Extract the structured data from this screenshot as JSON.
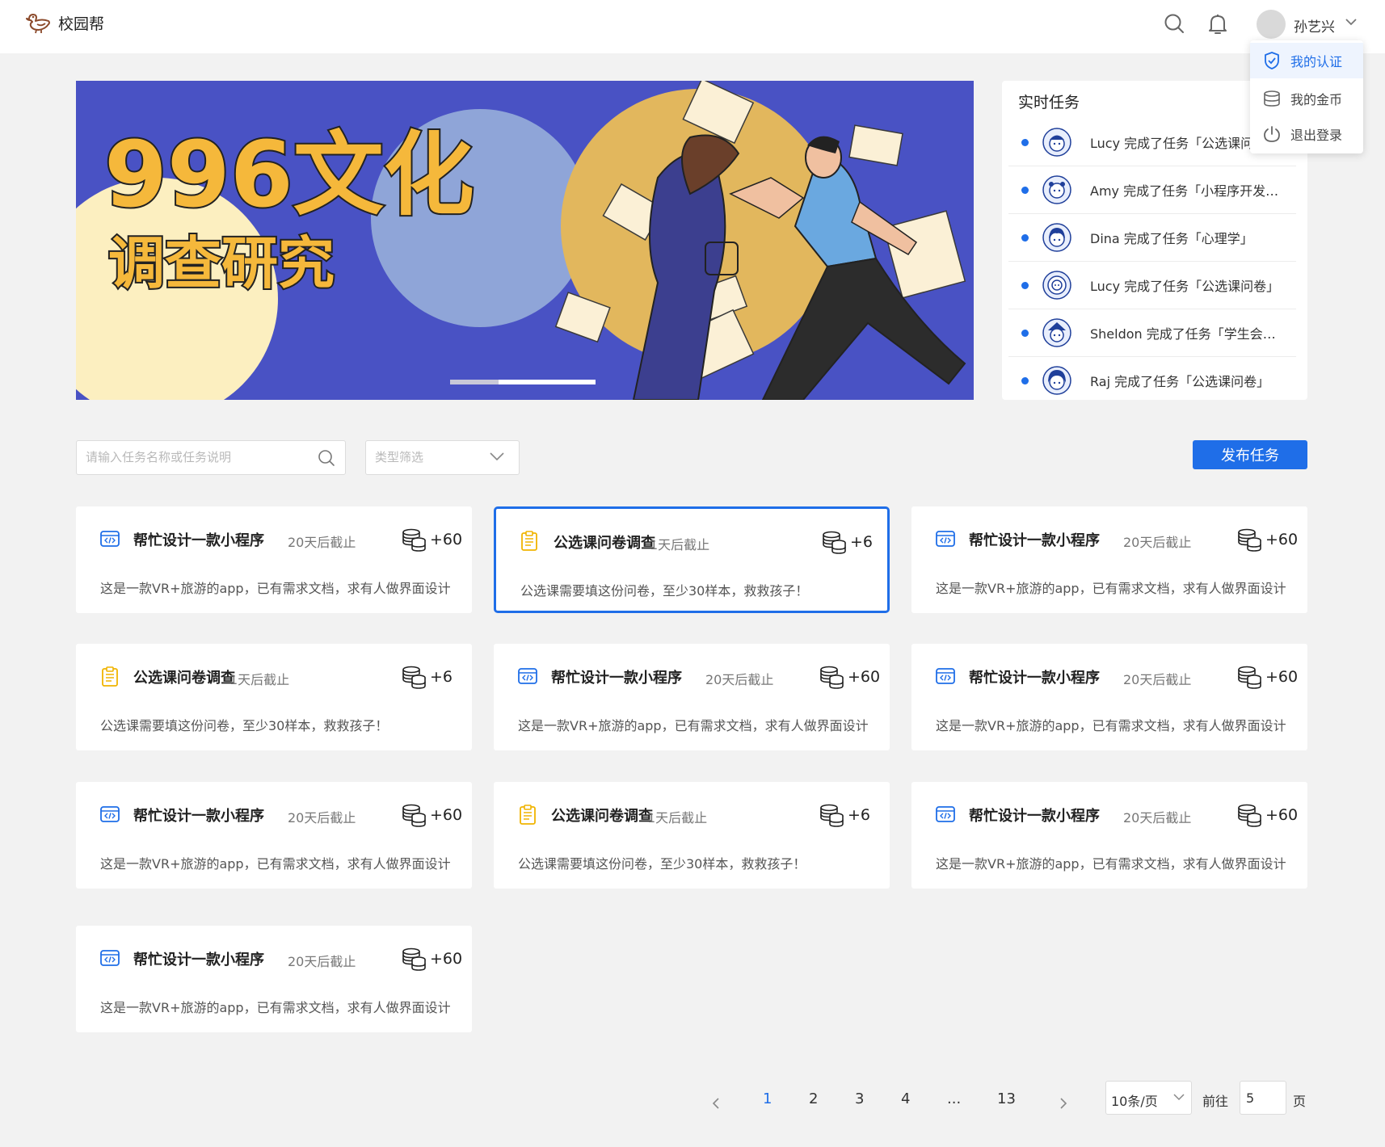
{
  "header": {
    "app_name": "校园帮",
    "user_name": "孙艺兴"
  },
  "user_menu": {
    "items": [
      {
        "label": "我的认证",
        "icon": "shield-check-icon",
        "active": true
      },
      {
        "label": "我的金币",
        "icon": "coins-icon",
        "active": false
      },
      {
        "label": "退出登录",
        "icon": "power-icon",
        "active": false
      }
    ]
  },
  "banner": {
    "line1": "996文化",
    "line2": "调查研究"
  },
  "realtime": {
    "title": "实时任务",
    "items": [
      "Lucy 完成了任务「公选课问卷」",
      "Amy 完成了任务「小程序开发…",
      "Dina 完成了任务「心理学」",
      "Lucy 完成了任务「公选课问卷」",
      "Sheldon 完成了任务「学生会…",
      "Raj 完成了任务「公选课问卷」"
    ]
  },
  "filters": {
    "search_placeholder": "请输入任务名称或任务说明",
    "type_placeholder": "类型筛选",
    "publish_label": "发布任务"
  },
  "tasks": [
    {
      "type": "code",
      "title": "帮忙设计一款小程序",
      "deadline": "20天后截止",
      "reward": "+60",
      "desc": "这是一款VR+旅游的app，已有需求文档，求有人做界面设计",
      "selected": false
    },
    {
      "type": "survey",
      "title": "公选课问卷调查",
      "deadline": "1天后截止",
      "reward": "+6",
      "desc": "公选课需要填这份问卷，至少30样本，救救孩子！",
      "selected": true
    },
    {
      "type": "code",
      "title": "帮忙设计一款小程序",
      "deadline": "20天后截止",
      "reward": "+60",
      "desc": "这是一款VR+旅游的app，已有需求文档，求有人做界面设计",
      "selected": false
    },
    {
      "type": "survey",
      "title": "公选课问卷调查",
      "deadline": "1天后截止",
      "reward": "+6",
      "desc": "公选课需要填这份问卷，至少30样本，救救孩子！",
      "selected": false
    },
    {
      "type": "code",
      "title": "帮忙设计一款小程序",
      "deadline": "20天后截止",
      "reward": "+60",
      "desc": "这是一款VR+旅游的app，已有需求文档，求有人做界面设计",
      "selected": false
    },
    {
      "type": "code",
      "title": "帮忙设计一款小程序",
      "deadline": "20天后截止",
      "reward": "+60",
      "desc": "这是一款VR+旅游的app，已有需求文档，求有人做界面设计",
      "selected": false
    },
    {
      "type": "code",
      "title": "帮忙设计一款小程序",
      "deadline": "20天后截止",
      "reward": "+60",
      "desc": "这是一款VR+旅游的app，已有需求文档，求有人做界面设计",
      "selected": false
    },
    {
      "type": "survey",
      "title": "公选课问卷调查",
      "deadline": "1天后截止",
      "reward": "+6",
      "desc": "公选课需要填这份问卷，至少30样本，救救孩子！",
      "selected": false
    },
    {
      "type": "code",
      "title": "帮忙设计一款小程序",
      "deadline": "20天后截止",
      "reward": "+60",
      "desc": "这是一款VR+旅游的app，已有需求文档，求有人做界面设计",
      "selected": false
    },
    {
      "type": "code",
      "title": "帮忙设计一款小程序",
      "deadline": "20天后截止",
      "reward": "+60",
      "desc": "这是一款VR+旅游的app，已有需求文档，求有人做界面设计",
      "selected": false
    }
  ],
  "pagination": {
    "pages": [
      "1",
      "2",
      "3",
      "4",
      "...",
      "13"
    ],
    "current": "1",
    "page_size": "10条/页",
    "goto_label": "前往",
    "goto_value": "5",
    "goto_unit": "页"
  },
  "colors": {
    "primary": "#1f6ee8",
    "banner_bg": "#4952c4",
    "banner_title": "#f5b83b",
    "survey_icon": "#f0b400"
  }
}
